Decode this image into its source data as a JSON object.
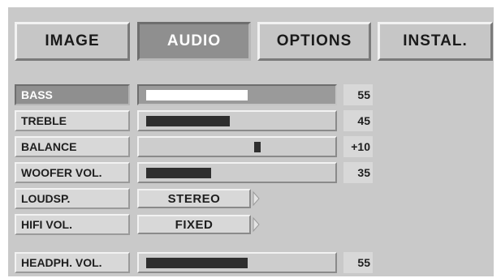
{
  "tabs": [
    {
      "label": "IMAGE",
      "active": false
    },
    {
      "label": "AUDIO",
      "active": true
    },
    {
      "label": "OPTIONS",
      "active": false
    },
    {
      "label": "INSTAL.",
      "active": false
    }
  ],
  "rows": [
    {
      "label": "BASS",
      "type": "slider",
      "value": "55",
      "level": 55,
      "selected": true
    },
    {
      "label": "TREBLE",
      "type": "slider",
      "value": "45",
      "level": 45
    },
    {
      "label": "BALANCE",
      "type": "balance",
      "value": "+10",
      "level": 10
    },
    {
      "label": "WOOFER VOL.",
      "type": "slider",
      "value": "35",
      "level": 35
    },
    {
      "label": "LOUDSP.",
      "type": "option",
      "option": "STEREO"
    },
    {
      "label": "HIFI VOL.",
      "type": "option",
      "option": "FIXED"
    },
    {
      "label": "HEADPH. VOL.",
      "type": "slider",
      "value": "55",
      "level": 55
    }
  ],
  "colors": {
    "background": "#c9c9c9",
    "active": "#8f8f8f",
    "bar_fill": "#2e2e2e",
    "selected_fill": "#ffffff"
  },
  "icons": {
    "option_arrow": "chevron-right-icon"
  }
}
